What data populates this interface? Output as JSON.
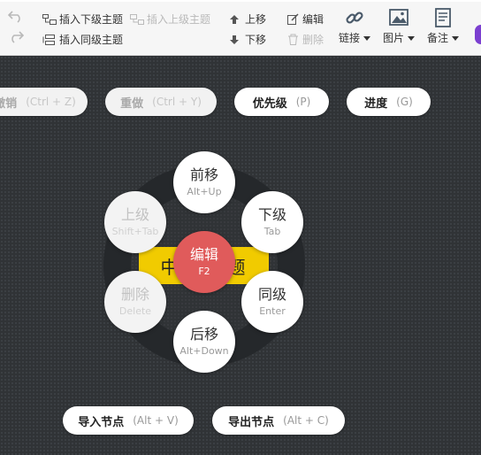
{
  "toolbar": {
    "insert_child": "插入下级主题",
    "insert_parent": "插入上级主题",
    "insert_sibling": "插入同级主题",
    "move_up": "上移",
    "move_down": "下移",
    "edit": "编辑",
    "delete": "删除",
    "link": "链接",
    "image": "图片",
    "note": "备注"
  },
  "canvas": {
    "undo": {
      "label": "撤销",
      "key": "(Ctrl + Z)"
    },
    "redo": {
      "label": "重做",
      "key": "(Ctrl + Y)"
    },
    "priority": {
      "label": "优先级",
      "key": "(P)"
    },
    "progress": {
      "label": "进度",
      "key": "(G)"
    },
    "import_node": {
      "label": "导入节点",
      "key": "(Alt + V)"
    },
    "export_node": {
      "label": "导出节点",
      "key": "(Alt + C)"
    },
    "topic_left": "中",
    "topic_right": "题"
  },
  "radial": {
    "forward": {
      "label": "前移",
      "key": "Alt+Up"
    },
    "child": {
      "label": "下级",
      "key": "Tab"
    },
    "sibling": {
      "label": "同级",
      "key": "Enter"
    },
    "backward": {
      "label": "后移",
      "key": "Alt+Down"
    },
    "delete": {
      "label": "删除",
      "key": "Delete"
    },
    "parent": {
      "label": "上级",
      "key": "Shift+Tab"
    },
    "edit": {
      "label": "编辑",
      "key": "F2"
    }
  },
  "colors": {
    "topic": "#f1cb00",
    "edit_center": "#e05b5b",
    "canvas_bg": "#303336"
  }
}
